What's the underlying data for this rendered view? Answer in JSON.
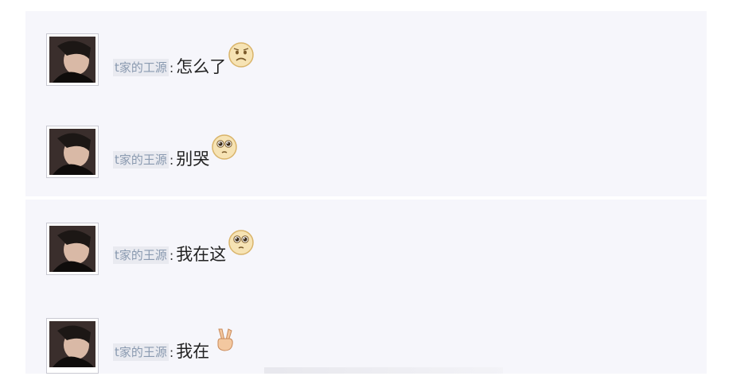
{
  "comments": [
    {
      "username": "t家的工源",
      "separator": ":",
      "text": "怎么了",
      "emoji": "worried-face-emoji"
    },
    {
      "username": "t家的王源",
      "separator": ":",
      "text": "别哭",
      "emoji": "pleading-eyes-emoji"
    },
    {
      "username": "t家的王源",
      "separator": ":",
      "text": "我在这",
      "emoji": "pleading-eyes-emoji"
    },
    {
      "username": "t家的王源",
      "separator": ":",
      "text": "我在",
      "emoji": "victory-hand-emoji"
    }
  ],
  "colors": {
    "panel_background": "#f6f6fb",
    "username_text": "#8a9ab0",
    "message_text": "#222222"
  }
}
